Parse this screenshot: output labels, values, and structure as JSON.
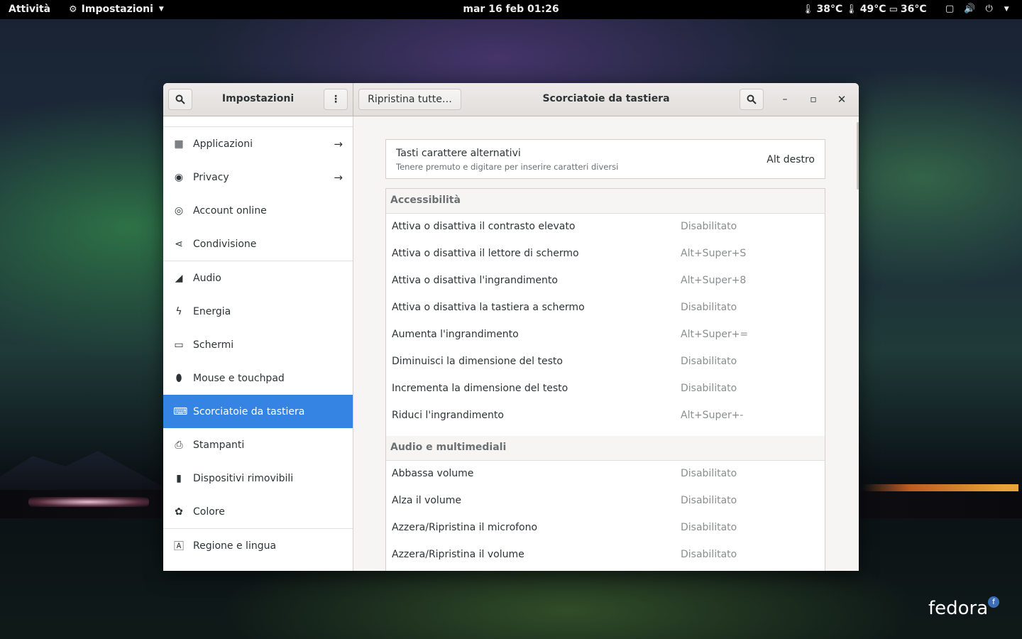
{
  "topbar": {
    "activities": "Attività",
    "app_menu": "Impostazioni",
    "clock": "mar 16 feb  01:26",
    "temps": [
      "38°C",
      "49°C",
      "36°C"
    ]
  },
  "branding": {
    "logo": "fedora"
  },
  "header": {
    "sidebar_title": "Impostazioni",
    "restore_button": "Ripristina tutte…",
    "page_title": "Scorciatoie da tastiera"
  },
  "sidebar": {
    "items": [
      {
        "label": "Applicazioni",
        "icon": "grid-icon",
        "arrow": true
      },
      {
        "label": "Privacy",
        "icon": "privacy-icon",
        "arrow": true
      },
      {
        "label": "Account online",
        "icon": "account-icon",
        "arrow": false
      },
      {
        "label": "Condivisione",
        "icon": "share-icon",
        "arrow": false
      },
      {
        "label": "Audio",
        "icon": "audio-icon",
        "arrow": false
      },
      {
        "label": "Energia",
        "icon": "power-icon",
        "arrow": false
      },
      {
        "label": "Schermi",
        "icon": "display-icon",
        "arrow": false
      },
      {
        "label": "Mouse e touchpad",
        "icon": "mouse-icon",
        "arrow": false
      },
      {
        "label": "Scorciatoie da tastiera",
        "icon": "keyboard-icon",
        "arrow": false,
        "active": true
      },
      {
        "label": "Stampanti",
        "icon": "printer-icon",
        "arrow": false
      },
      {
        "label": "Dispositivi rimovibili",
        "icon": "usb-icon",
        "arrow": false
      },
      {
        "label": "Colore",
        "icon": "color-icon",
        "arrow": false
      },
      {
        "label": "Regione e lingua",
        "icon": "language-icon",
        "arrow": false
      }
    ]
  },
  "alt_chars": {
    "title": "Tasti carattere alternativi",
    "subtitle": "Tenere premuto e digitare per inserire caratteri diversi",
    "value": "Alt destro"
  },
  "sections": [
    {
      "title": "Accessibilità",
      "rows": [
        {
          "name": "Attiva o disattiva il contrasto elevato",
          "value": "Disabilitato"
        },
        {
          "name": "Attiva o disattiva il lettore di schermo",
          "value": "Alt+Super+S"
        },
        {
          "name": "Attiva o disattiva l'ingrandimento",
          "value": "Alt+Super+8"
        },
        {
          "name": "Attiva o disattiva la tastiera a schermo",
          "value": "Disabilitato"
        },
        {
          "name": "Aumenta l'ingrandimento",
          "value": "Alt+Super+="
        },
        {
          "name": "Diminuisci la dimensione del testo",
          "value": "Disabilitato"
        },
        {
          "name": "Incrementa la dimensione del testo",
          "value": "Disabilitato"
        },
        {
          "name": "Riduci l'ingrandimento",
          "value": "Alt+Super+-"
        }
      ]
    },
    {
      "title": "Audio e multimediali",
      "rows": [
        {
          "name": "Abbassa volume",
          "value": "Disabilitato"
        },
        {
          "name": "Alza il volume",
          "value": "Disabilitato"
        },
        {
          "name": "Azzera/Ripristina il microfono",
          "value": "Disabilitato"
        },
        {
          "name": "Azzera/Ripristina il volume",
          "value": "Disabilitato"
        }
      ]
    }
  ]
}
